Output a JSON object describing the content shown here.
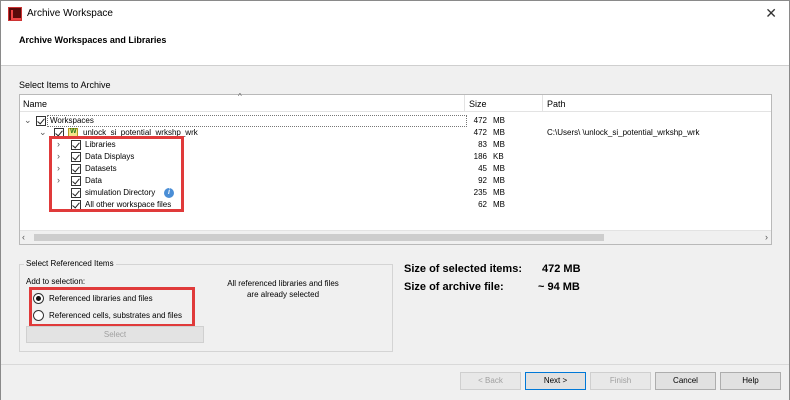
{
  "window": {
    "title": "Archive Workspace",
    "close_glyph": "✕"
  },
  "header": {
    "title": "Archive Workspaces and Libraries"
  },
  "items_section": {
    "label": "Select Items to Archive"
  },
  "tree": {
    "columns": {
      "name": "Name",
      "size": "Size",
      "path": "Path"
    },
    "rows": [
      {
        "label": "Workspaces",
        "size": "472",
        "unit": "MB",
        "path": ""
      },
      {
        "label": "unlock_si_potential_wrkshp_wrk",
        "size": "472",
        "unit": "MB",
        "path": "C:\\Users\\ \\unlock_si_potential_wrkshp_wrk"
      },
      {
        "label": "Libraries",
        "size": "83",
        "unit": "MB",
        "path": ""
      },
      {
        "label": "Data Displays",
        "size": "186",
        "unit": "KB",
        "path": ""
      },
      {
        "label": "Datasets",
        "size": "45",
        "unit": "MB",
        "path": ""
      },
      {
        "label": "Data",
        "size": "92",
        "unit": "MB",
        "path": ""
      },
      {
        "label": "simulation Directory",
        "size": "235",
        "unit": "MB",
        "path": ""
      },
      {
        "label": "All other workspace files",
        "size": "62",
        "unit": "MB",
        "path": ""
      }
    ]
  },
  "referenced": {
    "title": "Select Referenced Items",
    "add_label": "Add to selection:",
    "options": [
      {
        "label": "Referenced libraries and files",
        "selected": true
      },
      {
        "label": "Referenced cells, substrates and files",
        "selected": false
      }
    ],
    "note": "All referenced libraries and files are already selected",
    "select_button": "Select"
  },
  "stats": {
    "selected_label": "Size of selected items:",
    "selected_value": "472 MB",
    "archive_label": "Size of archive file:",
    "archive_value": "~ 94 MB"
  },
  "footer": {
    "back": "< Back",
    "next": "Next >",
    "finish": "Finish",
    "cancel": "Cancel",
    "help": "Help"
  },
  "colors": {
    "highlight": "#e03a3a",
    "accent": "#0078d7"
  }
}
